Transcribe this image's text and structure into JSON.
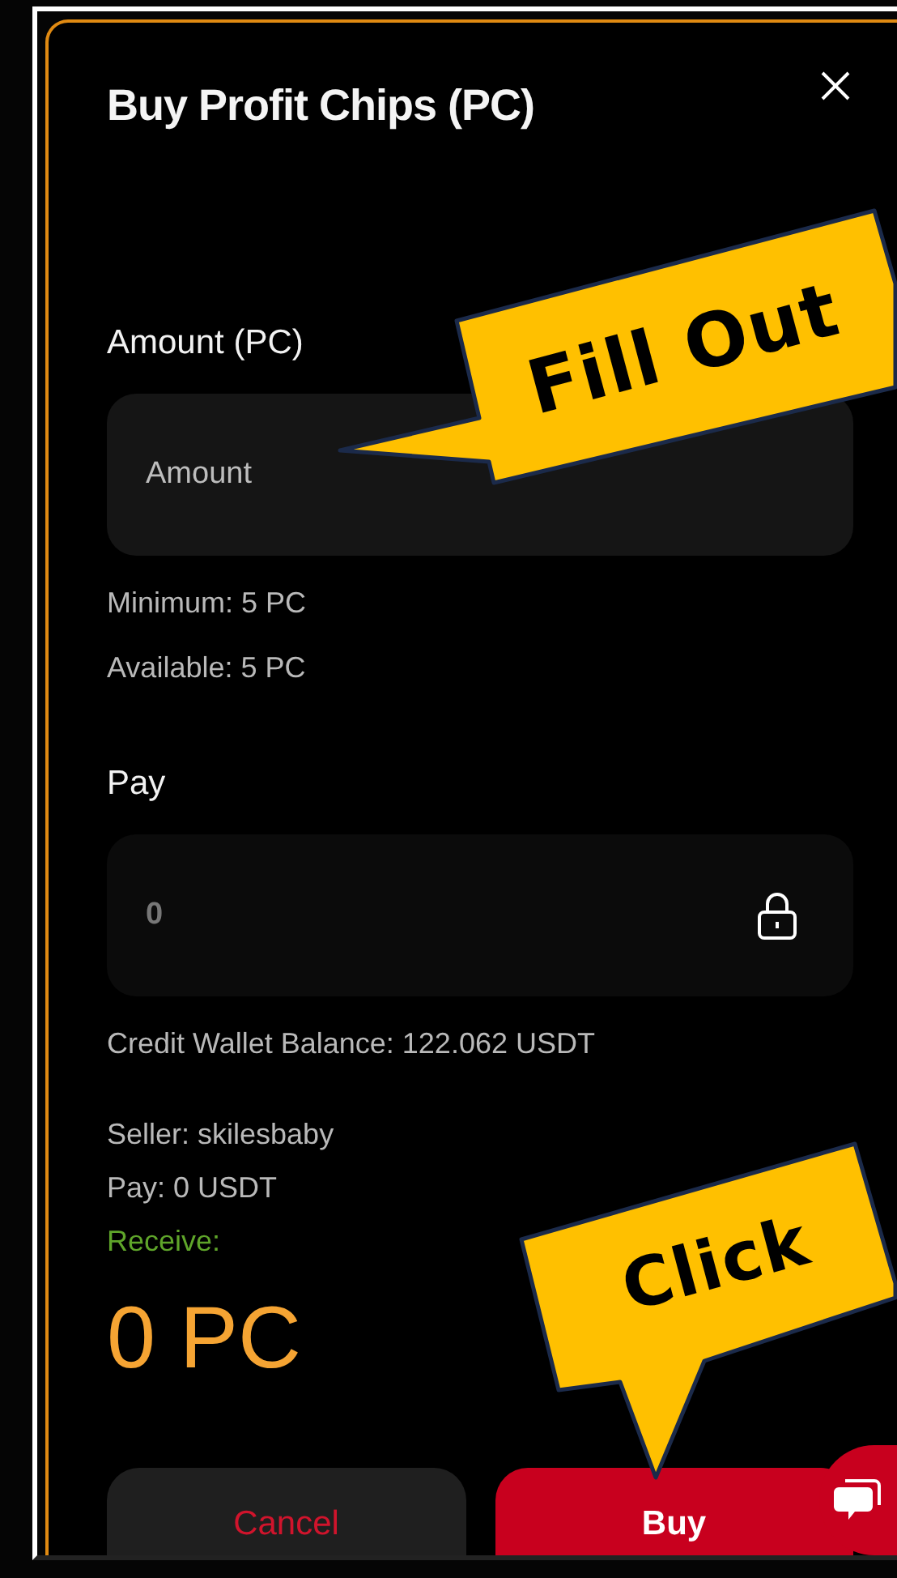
{
  "dialog": {
    "title": "Buy Profit Chips (PC)"
  },
  "amount": {
    "label": "Amount (PC)",
    "placeholder": "Amount"
  },
  "limits": [
    "Minimum: 5 PC",
    "Available: 5 PC"
  ],
  "pay": {
    "label": "Pay",
    "value": "0",
    "locked": true
  },
  "balance": "Credit Wallet Balance: 122.062 USDT",
  "summary": [
    {
      "text": "Seller: skilesbaby",
      "kind": "info"
    },
    {
      "text": "Pay: 0 USDT",
      "kind": "info"
    },
    {
      "text": "Receive:",
      "kind": "highlight"
    }
  ],
  "receive_amount": "0 PC",
  "buttons": [
    {
      "label": "Cancel",
      "kind": "secondary"
    },
    {
      "label": "Buy",
      "kind": "primary"
    }
  ],
  "callouts": [
    {
      "text": "Fill Out"
    },
    {
      "text": "Click"
    }
  ]
}
